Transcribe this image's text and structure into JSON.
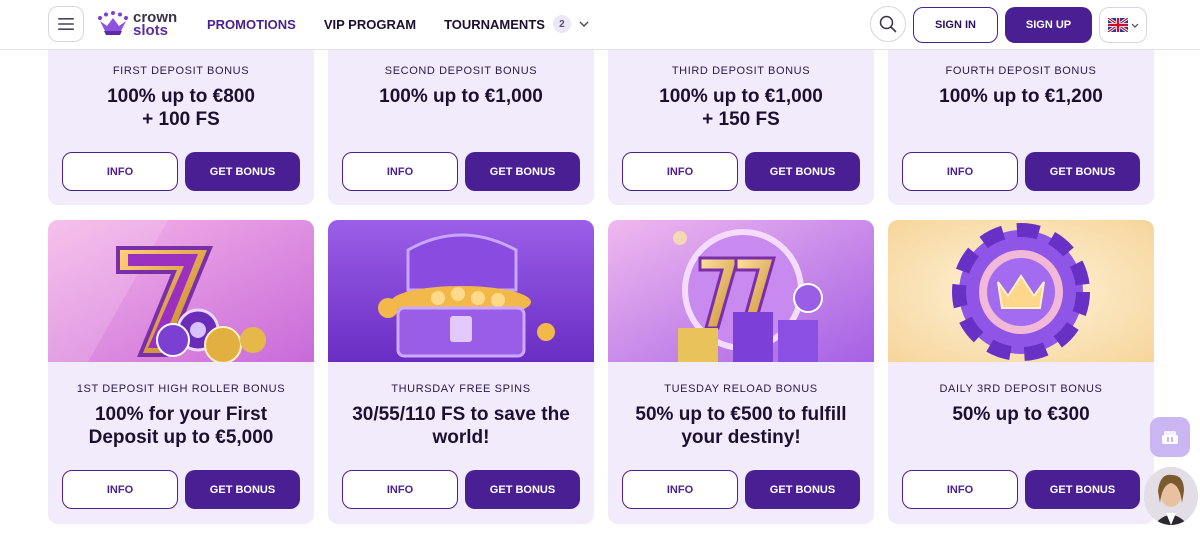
{
  "header": {
    "logo": {
      "line1": "crown",
      "line2": "slots"
    },
    "nav": [
      {
        "label": "PROMOTIONS"
      },
      {
        "label": "VIP PROGRAM"
      },
      {
        "label": "TOURNAMENTS",
        "badge": "2"
      }
    ],
    "signin_label": "SIGN IN",
    "signup_label": "SIGN UP",
    "language_icon": "uk-flag-icon"
  },
  "buttons": {
    "info": "INFO",
    "get_bonus": "GET BONUS"
  },
  "cards": [
    {
      "kicker": "FIRST DEPOSIT BONUS",
      "title": "100% up to €800\n+ 100 FS"
    },
    {
      "kicker": "SECOND DEPOSIT BONUS",
      "title": "100% up to €1,000"
    },
    {
      "kicker": "THIRD DEPOSIT BONUS",
      "title": "100% up to €1,000\n+ 150 FS"
    },
    {
      "kicker": "FOURTH DEPOSIT BONUS",
      "title": "100% up to €1,200"
    },
    {
      "kicker": "1ST DEPOSIT HIGH ROLLER BONUS",
      "title": "100% for your First Deposit up to €5,000",
      "image": "lucky-seven-chips"
    },
    {
      "kicker": "THURSDAY FREE SPINS",
      "title": "30/55/110 FS to save the world!",
      "image": "treasure-chest"
    },
    {
      "kicker": "TUESDAY RELOAD BONUS",
      "title": "50% up to €500 to fulfill your destiny!",
      "image": "seventy-seven-chips"
    },
    {
      "kicker": "DAILY 3RD DEPOSIT BONUS",
      "title": "50% up to €300",
      "image": "crown-chip"
    }
  ],
  "colors": {
    "primary": "#4b1f94",
    "card_bg": "#f1ebfb"
  }
}
